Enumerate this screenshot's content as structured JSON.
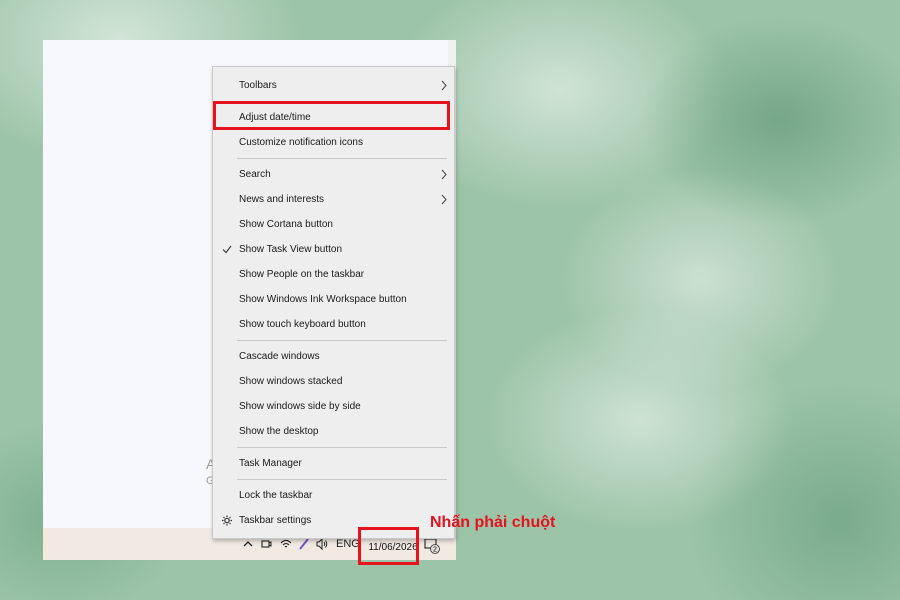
{
  "menu": {
    "items": [
      {
        "label": "Toolbars"
      },
      {
        "label": "Adjust date/time"
      },
      {
        "label": "Customize notification icons"
      },
      {
        "label": "Search"
      },
      {
        "label": "News and interests"
      },
      {
        "label": "Show Cortana button"
      },
      {
        "label": "Show Task View button"
      },
      {
        "label": "Show People on the taskbar"
      },
      {
        "label": "Show Windows Ink Workspace button"
      },
      {
        "label": "Show touch keyboard button"
      },
      {
        "label": "Cascade windows"
      },
      {
        "label": "Show windows stacked"
      },
      {
        "label": "Show windows side by side"
      },
      {
        "label": "Show the desktop"
      },
      {
        "label": "Task Manager"
      },
      {
        "label": "Lock the taskbar"
      },
      {
        "label": "Taskbar settings"
      }
    ]
  },
  "watermark": {
    "title": "Activate Windows",
    "subtitle": "Go to Settings to activate Windows."
  },
  "tray": {
    "language": "ENG",
    "date": "11/06/2026",
    "notification_count": "2"
  },
  "annotation": {
    "caption": "Nhấn phải chuột",
    "color": "#e6121d"
  }
}
